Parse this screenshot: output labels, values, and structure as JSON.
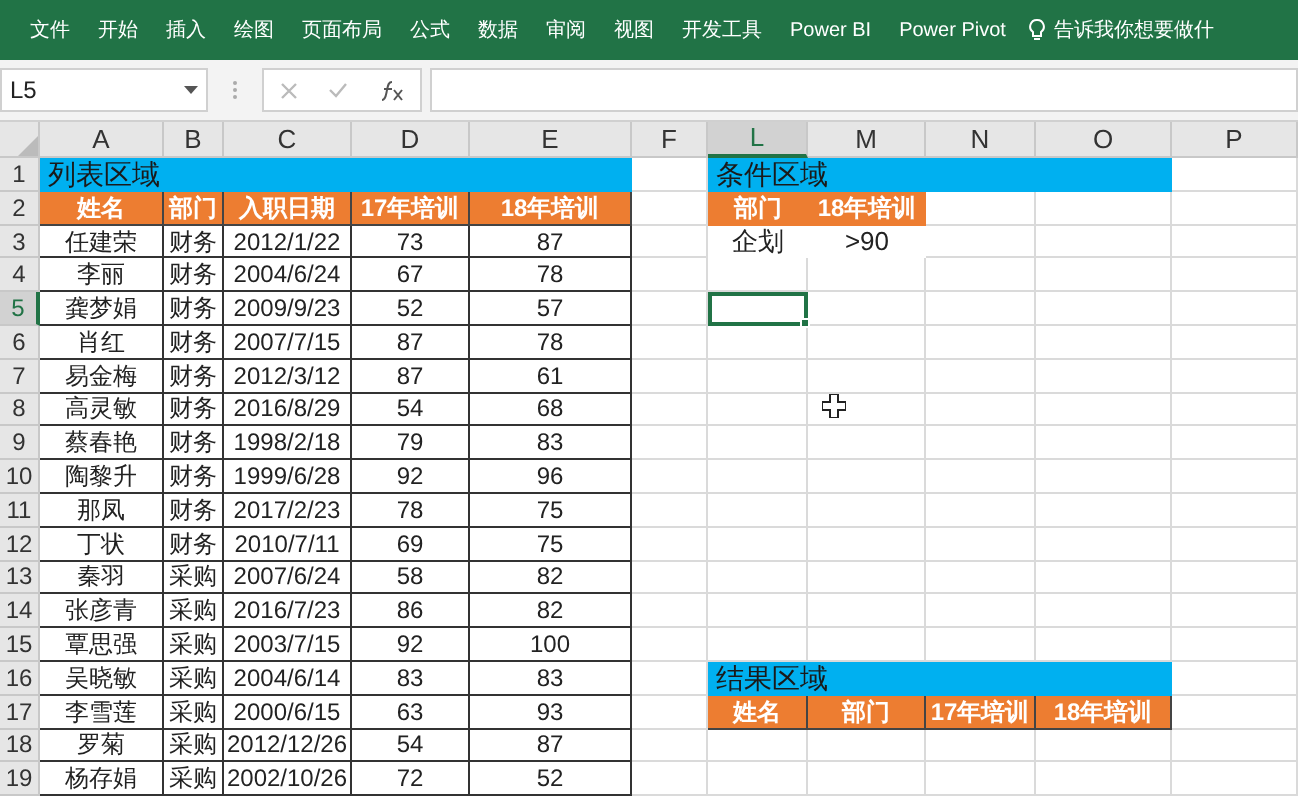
{
  "ribbon": {
    "tabs": [
      "文件",
      "开始",
      "插入",
      "绘图",
      "页面布局",
      "公式",
      "数据",
      "审阅",
      "视图",
      "开发工具",
      "Power BI",
      "Power Pivot"
    ],
    "tell_me": "告诉我你想要做什"
  },
  "formula_bar": {
    "name_box": "L5"
  },
  "columns": [
    {
      "label": "A",
      "selected": false
    },
    {
      "label": "B",
      "selected": false
    },
    {
      "label": "C",
      "selected": false
    },
    {
      "label": "D",
      "selected": false
    },
    {
      "label": "E",
      "selected": false
    },
    {
      "label": "F",
      "selected": false
    },
    {
      "label": "L",
      "selected": true
    },
    {
      "label": "M",
      "selected": false
    },
    {
      "label": "N",
      "selected": false
    },
    {
      "label": "O",
      "selected": false
    },
    {
      "label": "P",
      "selected": false
    }
  ],
  "rows": [
    {
      "label": "1",
      "selected": false
    },
    {
      "label": "2",
      "selected": false
    },
    {
      "label": "3",
      "selected": false
    },
    {
      "label": "4",
      "selected": false
    },
    {
      "label": "5",
      "selected": true
    },
    {
      "label": "6",
      "selected": false
    },
    {
      "label": "7",
      "selected": false
    },
    {
      "label": "8",
      "selected": false
    },
    {
      "label": "9",
      "selected": false
    },
    {
      "label": "10",
      "selected": false
    },
    {
      "label": "11",
      "selected": false
    },
    {
      "label": "12",
      "selected": false
    },
    {
      "label": "13",
      "selected": false
    },
    {
      "label": "14",
      "selected": false
    },
    {
      "label": "15",
      "selected": false
    },
    {
      "label": "16",
      "selected": false
    },
    {
      "label": "17",
      "selected": false
    },
    {
      "label": "18",
      "selected": false
    },
    {
      "label": "19",
      "selected": false
    }
  ],
  "list_region": {
    "title": "列表区域",
    "headers": [
      "姓名",
      "部门",
      "入职日期",
      "17年培训",
      "18年培训"
    ],
    "records": [
      [
        "任建荣",
        "财务",
        "2012/1/22",
        "73",
        "87"
      ],
      [
        "李丽",
        "财务",
        "2004/6/24",
        "67",
        "78"
      ],
      [
        "龚梦娟",
        "财务",
        "2009/9/23",
        "52",
        "57"
      ],
      [
        "肖红",
        "财务",
        "2007/7/15",
        "87",
        "78"
      ],
      [
        "易金梅",
        "财务",
        "2012/3/12",
        "87",
        "61"
      ],
      [
        "高灵敏",
        "财务",
        "2016/8/29",
        "54",
        "68"
      ],
      [
        "蔡春艳",
        "财务",
        "1998/2/18",
        "79",
        "83"
      ],
      [
        "陶黎升",
        "财务",
        "1999/6/28",
        "92",
        "96"
      ],
      [
        "那凤",
        "财务",
        "2017/2/23",
        "78",
        "75"
      ],
      [
        "丁状",
        "财务",
        "2010/7/11",
        "69",
        "75"
      ],
      [
        "秦羽",
        "采购",
        "2007/6/24",
        "58",
        "82"
      ],
      [
        "张彦青",
        "采购",
        "2016/7/23",
        "86",
        "82"
      ],
      [
        "覃思强",
        "采购",
        "2003/7/15",
        "92",
        "100"
      ],
      [
        "吴晓敏",
        "采购",
        "2004/6/14",
        "83",
        "83"
      ],
      [
        "李雪莲",
        "采购",
        "2000/6/15",
        "63",
        "93"
      ],
      [
        "罗菊",
        "采购",
        "2012/12/26",
        "54",
        "87"
      ],
      [
        "杨存娟",
        "采购",
        "2002/10/26",
        "72",
        "52"
      ]
    ]
  },
  "criteria_region": {
    "title": "条件区域",
    "headers": [
      "部门",
      "18年培训"
    ],
    "values": [
      "企划",
      ">90"
    ]
  },
  "result_region": {
    "title": "结果区域",
    "headers": [
      "姓名",
      "部门",
      "17年培训",
      "18年培训"
    ]
  }
}
